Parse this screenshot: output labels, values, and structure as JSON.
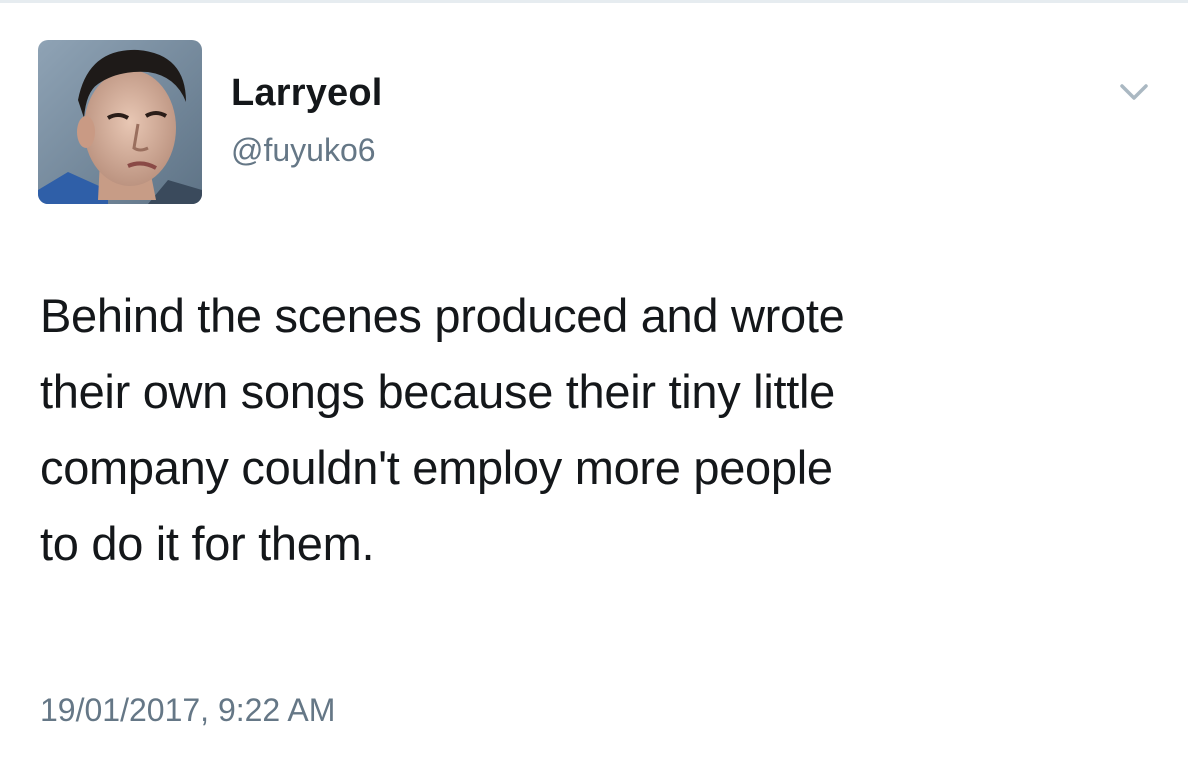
{
  "tweet": {
    "display_name": "Larryeol",
    "handle": "@fuyuko6",
    "text": "Behind the scenes produced and wrote\ntheir own songs because their tiny little\ncompany couldn't employ more people\nto do it for them.",
    "timestamp": "19/01/2017, 9:22 AM",
    "menu_icon": "chevron-down-icon",
    "avatar_icon": "user-avatar-photo"
  },
  "colors": {
    "text": "#14171a",
    "secondary": "#657786",
    "chevron": "#aab8c2",
    "border": "#e6ecf0"
  }
}
